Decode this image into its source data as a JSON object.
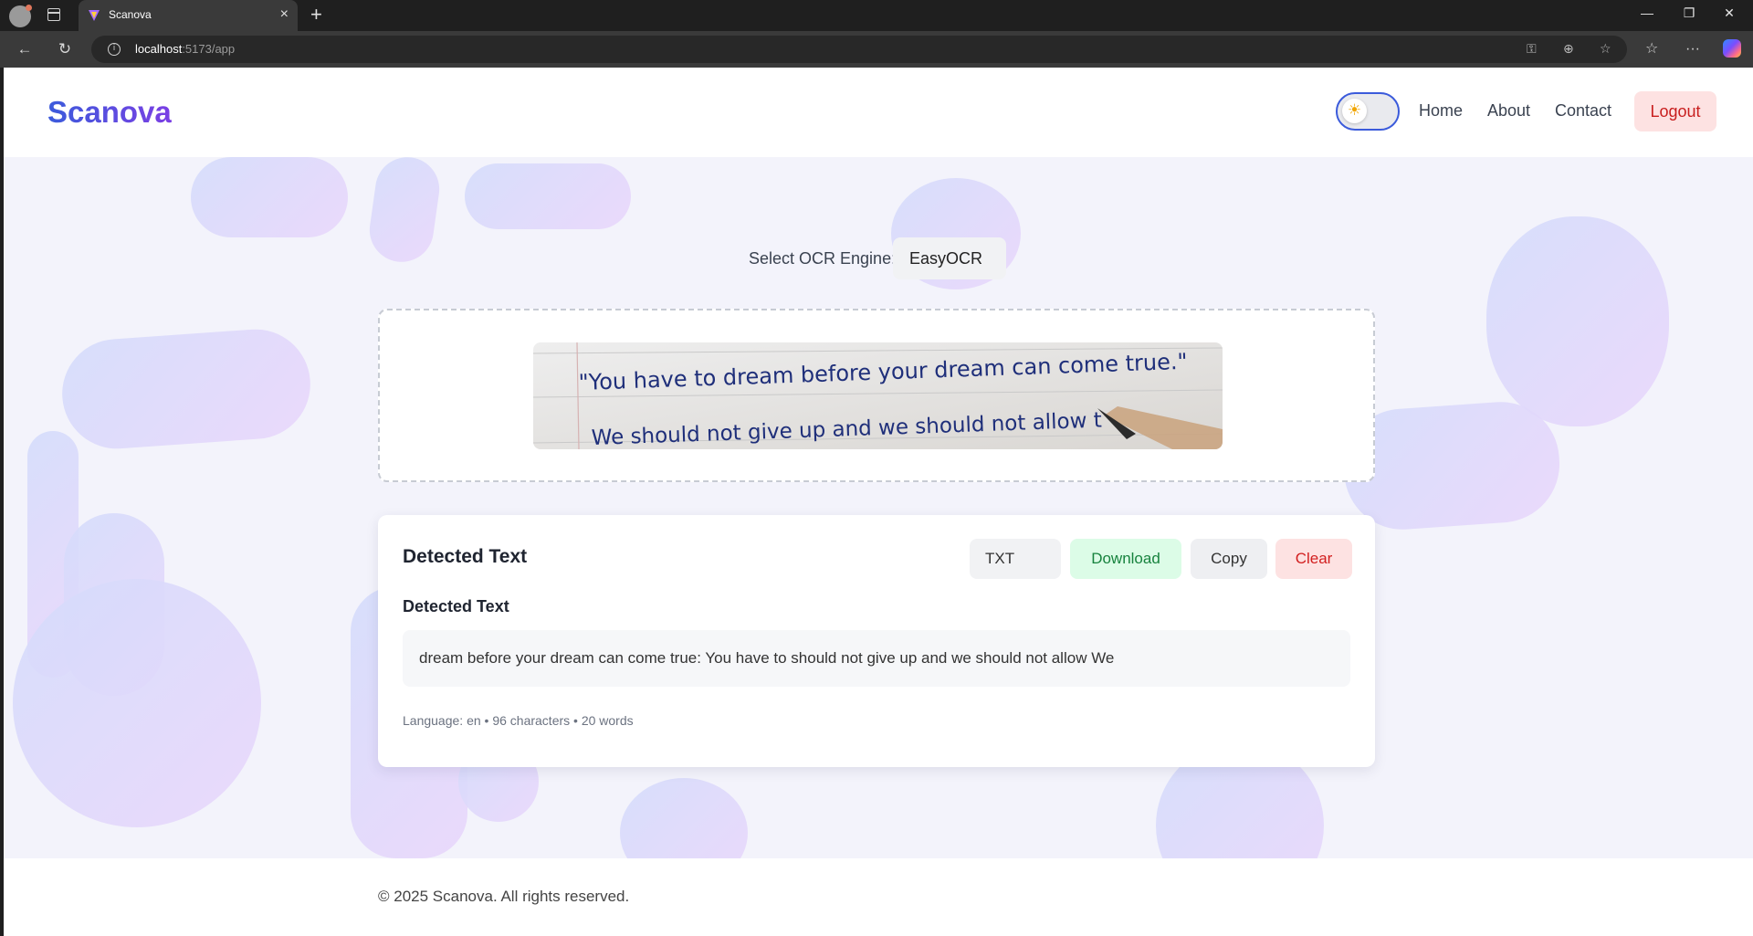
{
  "browser": {
    "tab_title": "Scanova",
    "url_host": "localhost",
    "url_rest": ":5173/app"
  },
  "header": {
    "logo": "Scanova",
    "nav": [
      "Home",
      "About",
      "Contact"
    ],
    "logout_label": "Logout",
    "theme_mode": "light"
  },
  "ocr": {
    "engine_label": "Select OCR Engine:",
    "engine_value": "EasyOCR",
    "image_line_1": "\"You have to dream before your dream can come true.\"",
    "image_line_2": "We should not give up and we should not allow t"
  },
  "result": {
    "card_title": "Detected Text",
    "format_value": "TXT",
    "download_label": "Download",
    "copy_label": "Copy",
    "clear_label": "Clear",
    "section_title": "Detected Text",
    "text": "dream before your dream can come true: You have to should not give up and we should not allow We",
    "meta": "Language: en • 96 characters • 20 words"
  },
  "footer": {
    "copyright": "© 2025 Scanova. All rights reserved."
  },
  "colors": {
    "brand_start": "#3b5bdb",
    "brand_end": "#7b3fe4",
    "download_bg": "#dcfce7",
    "clear_bg": "#fde2e2",
    "page_bg": "#f3f3fb"
  }
}
